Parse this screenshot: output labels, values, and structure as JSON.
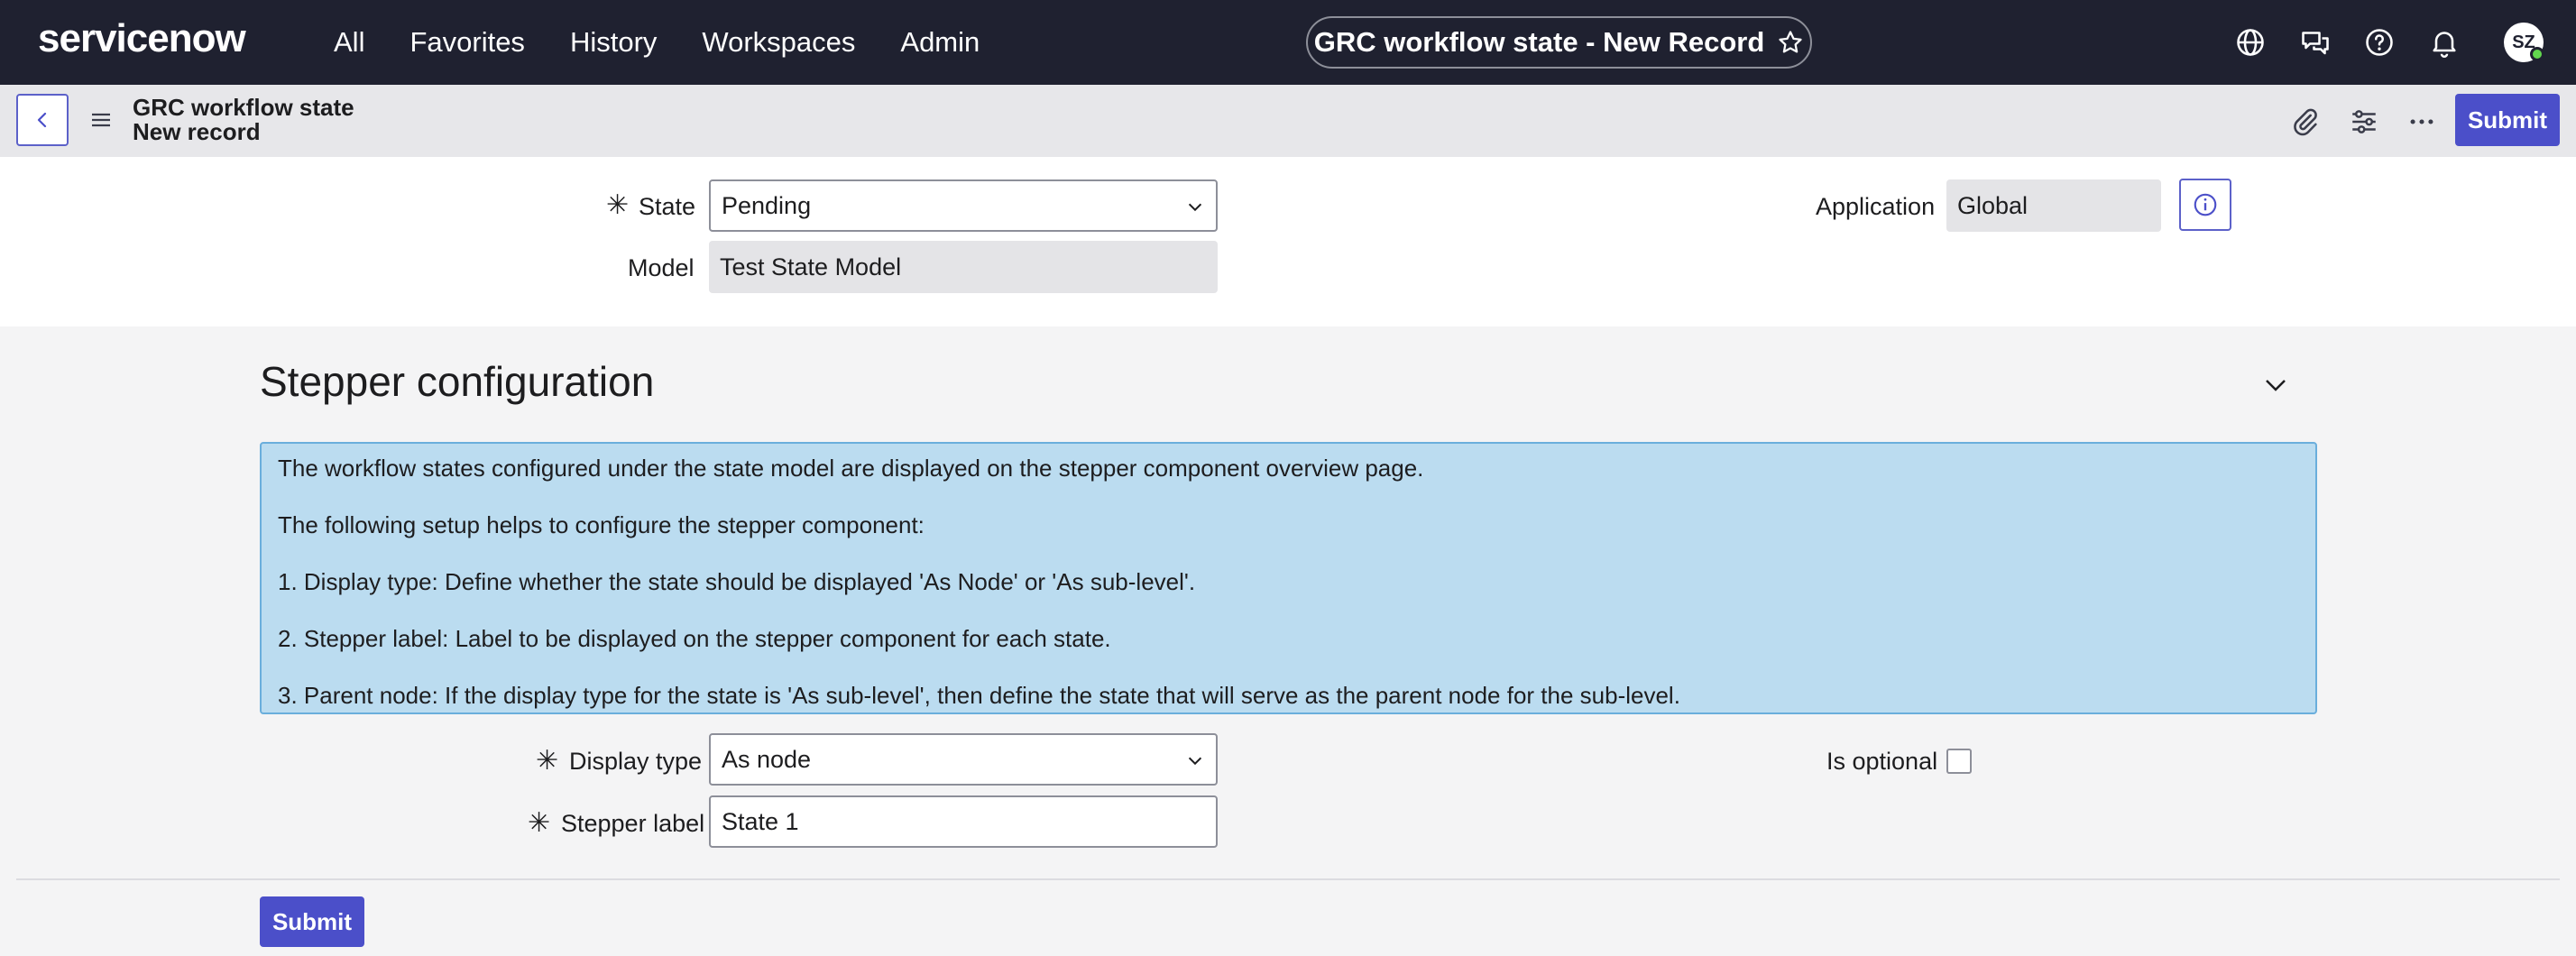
{
  "topnav": {
    "logo": "servicenow",
    "menu": [
      "All",
      "Favorites",
      "History",
      "Workspaces",
      "Admin"
    ],
    "record_title": "GRC workflow state - New Record",
    "avatar_initials": "SZ"
  },
  "subheader": {
    "table_name": "GRC workflow state",
    "record_name": "New record",
    "submit_label": "Submit"
  },
  "fields": {
    "state": {
      "label": "State",
      "value": "Pending",
      "required": true
    },
    "model": {
      "label": "Model",
      "value": "Test State Model"
    },
    "application": {
      "label": "Application",
      "value": "Global"
    },
    "display_type": {
      "label": "Display type",
      "value": "As node",
      "required": true
    },
    "stepper_label": {
      "label": "Stepper label",
      "value": "State 1",
      "required": true
    },
    "is_optional": {
      "label": "Is optional",
      "checked": false
    }
  },
  "section": {
    "title": "Stepper configuration",
    "info_lines": [
      "The workflow states configured under the state model are displayed on the stepper component overview page.",
      "The following setup helps to configure the stepper component:",
      "1. Display type: Define whether the state should be displayed 'As Node' or 'As sub-level'.",
      "2. Stepper label: Label to be displayed on the stepper component for each state.",
      "3. Parent node: If the display type for the state is 'As sub-level', then define the state that will serve as the parent node for the sub-level."
    ]
  },
  "footer": {
    "submit_label": "Submit"
  },
  "colors": {
    "nav_bg": "#1f2130",
    "accent": "#4b4fc9",
    "info_bg": "#bbdcf0",
    "brand_green": "#62d84e"
  },
  "icons": [
    "globe-icon",
    "chat-icon",
    "help-icon",
    "bell-icon",
    "attachment-icon",
    "settings-icon",
    "more-icon",
    "info-icon",
    "chevron-down-icon",
    "star-icon",
    "menu-icon",
    "back-icon"
  ]
}
